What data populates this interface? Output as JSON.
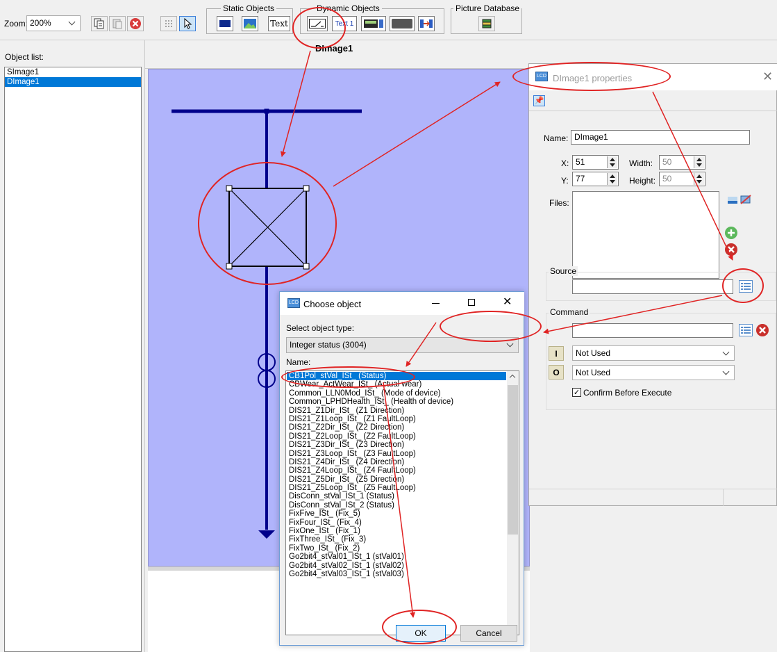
{
  "toolbar": {
    "zoom_label": "Zoom:",
    "zoom_value": "200%",
    "groups": {
      "static": "Static Objects",
      "dynamic": "Dynamic Objects",
      "picture": "Picture Database"
    },
    "text_tool": "Text",
    "text1_tool": "Text 1"
  },
  "object_list": {
    "label": "Object list:",
    "items": [
      "SImage1",
      "DImage1"
    ],
    "selected": "DImage1"
  },
  "canvas": {
    "title": "DImage1"
  },
  "properties": {
    "title": "DImage1 properties",
    "name_label": "Name:",
    "name_value": "DImage1",
    "x_label": "X:",
    "x_value": "51",
    "y_label": "Y:",
    "y_value": "77",
    "width_label": "Width:",
    "width_value": "50",
    "height_label": "Height:",
    "height_value": "50",
    "files_label": "Files:",
    "source_label": "Source",
    "command_label": "Command",
    "cmd1_value": "Not Used",
    "cmd2_value": "Not Used",
    "cmd1_marker": "I",
    "cmd2_marker": "O",
    "confirm_label": "Confirm Before Execute"
  },
  "chooser": {
    "title": "Choose object",
    "type_label": "Select object type:",
    "type_value": "Integer status (3004)",
    "name_label": "Name:",
    "items": [
      "CB1Pol_stVal_ISt_ (Status)",
      "CBWear_ActWear_ISt_ (Actual wear)",
      "Common_LLN0Mod_ISt_ (Mode of device)",
      "Common_LPHDHealth_ISt_ (Health of device)",
      "DIS21_Z1Dir_ISt_ (Z1 Direction)",
      "DIS21_Z1Loop_ISt_ (Z1 FaultLoop)",
      "DIS21_Z2Dir_ISt_ (Z2 Direction)",
      "DIS21_Z2Loop_ISt_ (Z2 FaultLoop)",
      "DIS21_Z3Dir_ISt_ (Z3 Direction)",
      "DIS21_Z3Loop_ISt_ (Z3 FaultLoop)",
      "DIS21_Z4Dir_ISt_ (Z4 Direction)",
      "DIS21_Z4Loop_ISt_ (Z4 FaultLoop)",
      "DIS21_Z5Dir_ISt_ (Z5 Direction)",
      "DIS21_Z5Loop_ISt_ (Z5 FaultLoop)",
      "DisConn_stVal_ISt_1 (Status)",
      "DisConn_stVal_ISt_2 (Status)",
      "FixFive_ISt_ (Fix_5)",
      "FixFour_ISt_ (Fix_4)",
      "FixOne_ISt_ (Fix_1)",
      "FixThree_ISt_ (Fix_3)",
      "FixTwo_ISt_ (Fix_2)",
      "Go2bit4_stVal01_ISt_1 (stVal01)",
      "Go2bit4_stVal02_ISt_1 (stVal02)",
      "Go2bit4_stVal03_ISt_1 (stVal03)"
    ],
    "selected_index": 0,
    "ok_label": "OK",
    "cancel_label": "Cancel"
  },
  "colors": {
    "canvas_bg": "#b0b4fb",
    "diagram_line": "#00008b",
    "selection": "#0078d7",
    "annotation": "#e02424"
  }
}
